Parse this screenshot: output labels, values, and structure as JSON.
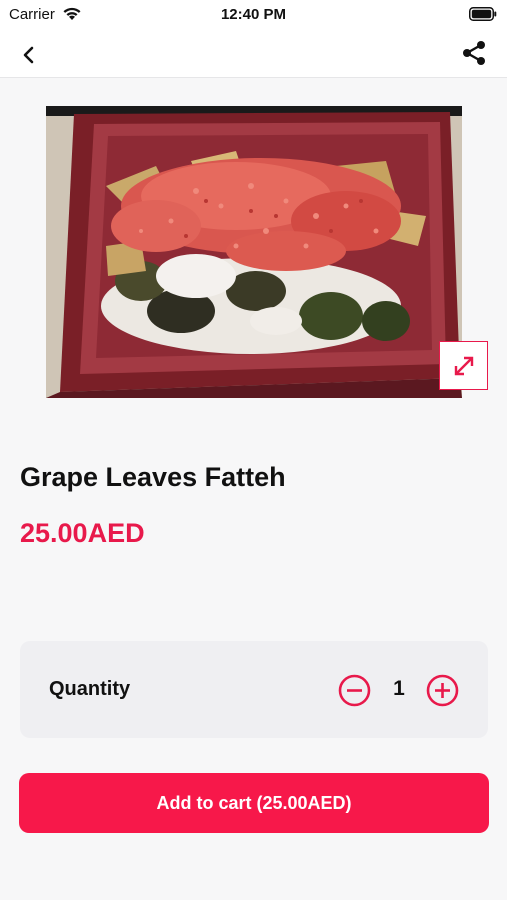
{
  "status_bar": {
    "carrier": "Carrier",
    "time": "12:40 PM"
  },
  "nav": {
    "back_icon": "chevron-left-icon",
    "share_icon": "share-icon"
  },
  "product": {
    "image_alt": "food-photo",
    "title": "Grape Leaves Fatteh",
    "price": "25.00AED"
  },
  "quantity": {
    "label": "Quantity",
    "value": "1"
  },
  "cart": {
    "button_label": "Add to cart (25.00AED)"
  },
  "colors": {
    "accent": "#e8194b",
    "button": "#f7184a",
    "card": "#efeff2",
    "background": "#f7f7f8"
  }
}
